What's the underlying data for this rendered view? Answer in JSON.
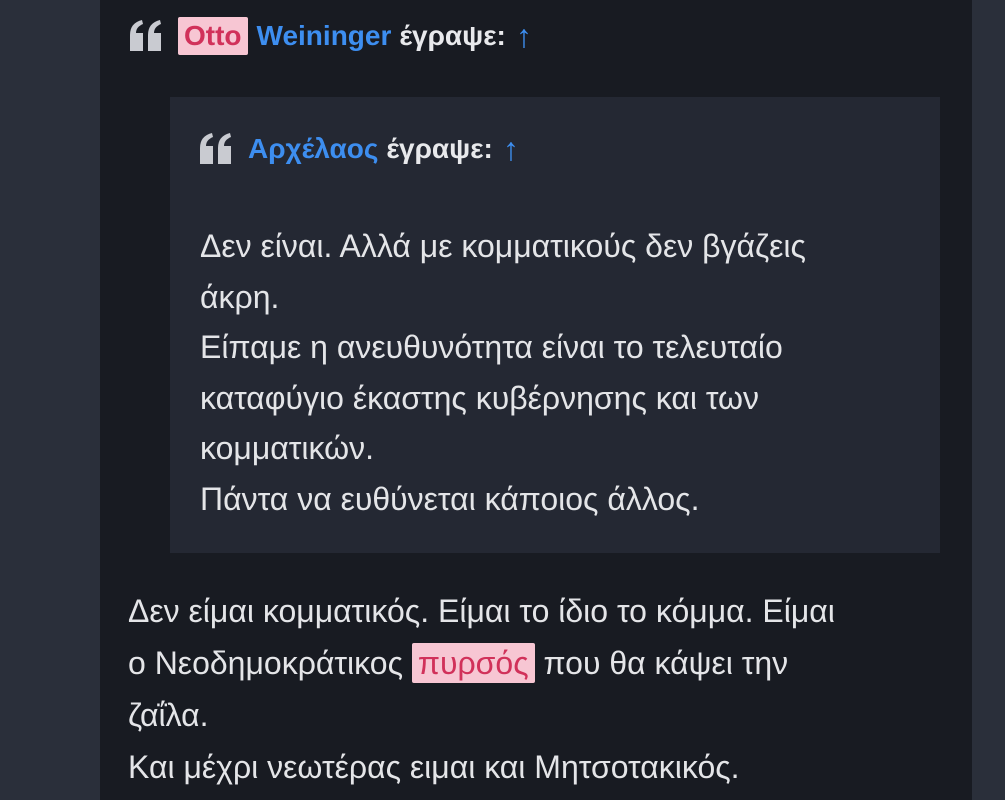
{
  "outer_quote": {
    "author_highlight": "Otto",
    "author_rest": "Weininger",
    "wrote_label": "έγραψε:",
    "arrow": "↑"
  },
  "inner_quote": {
    "author": "Αρχέλαος",
    "wrote_label": "έγραψε:",
    "arrow": "↑",
    "lines": [
      "Δεν είναι. Αλλά με κομματικούς δεν βγάζεις",
      "άκρη.",
      "Είπαμε η ανευθυνότητα είναι το τελευταίο",
      "καταφύγιο έκαστης κυβέρνησης και των",
      "κομματικών.",
      "Πάντα να ευθύνεται κάποιος άλλος."
    ]
  },
  "reply": {
    "line1": "Δεν είμαι κομματικός. Είμαι το ίδιο το κόμμα. Είμαι",
    "line2_before": "ο Νεοδημοκράτικος ",
    "line2_highlight": "πυρσός",
    "line2_after": " που θα κάψει την",
    "line3": "ζαΐλα.",
    "line4": "Και μέχρι νεωτέρας ειμαι και Μητσοτακικός."
  },
  "icons": {
    "quote": "quote-icon",
    "arrow": "arrow-up-icon"
  },
  "colors": {
    "page_bg": "#2a2f3a",
    "post_bg": "#181b22",
    "inner_quote_bg": "#242833",
    "link_blue": "#3d8ef0",
    "highlight_bg": "#f7c6d3",
    "highlight_text": "#d1315a",
    "text": "#e4e5e8"
  }
}
